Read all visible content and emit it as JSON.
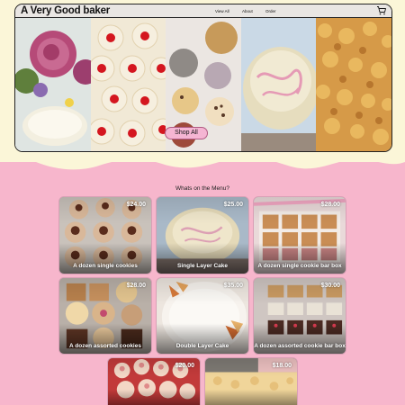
{
  "site": {
    "brand": "A Very Good baker",
    "nav": [
      {
        "label": "View All"
      },
      {
        "label": "About"
      },
      {
        "label": "Order"
      }
    ],
    "cart_icon": "shopping-cart-icon"
  },
  "hero": {
    "shop_button": "Shop All",
    "photos": [
      "roses-and-cake",
      "thumbprint-cookies",
      "assorted-cookies",
      "pink-frosted-cake",
      "crumb-cake"
    ]
  },
  "menu": {
    "heading": "Whats on the Menu?",
    "items": [
      {
        "name": "A dozen single cookies",
        "price": "$24.00"
      },
      {
        "name": "Single Layer Cake",
        "price": "$25.00"
      },
      {
        "name": "A dozen single cookie bar box",
        "price": "$28.00"
      },
      {
        "name": "A dozen assorted cookies",
        "price": "$28.00"
      },
      {
        "name": "Double Layer Cake",
        "price": "$35.00"
      },
      {
        "name": "A dozen assorted cookie bar box",
        "price": "$30.00"
      },
      {
        "name": "",
        "price": "$20.00"
      },
      {
        "name": "",
        "price": "$18.00"
      }
    ]
  },
  "colors": {
    "page_pink": "#f7b6cc",
    "cream": "#fbf6d8",
    "button_pink": "#f5b5d3",
    "nav_gray": "#e9e6e3"
  }
}
